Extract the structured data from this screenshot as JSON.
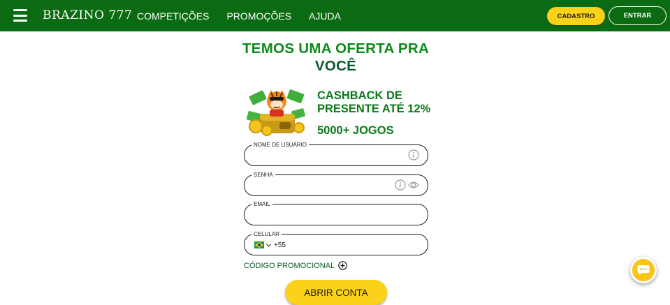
{
  "header": {
    "logo": "BRAZINO 777",
    "nav": [
      "COMPETIÇÕES",
      "PROMOÇÕES",
      "AJUDA"
    ],
    "signup_label": "CADASTRO",
    "login_label": "ENTRAR"
  },
  "hero": {
    "headline_line1": "TEMOS UMA OFERTA PRA",
    "headline_line2": "VOCÊ",
    "offer_line1": "CASHBACK DE",
    "offer_line2": "PRESENTE ATÉ 12%",
    "games": "5000+ JOGOS"
  },
  "form": {
    "username_label": "NOME DE USUÁRIO",
    "password_label": "SENHA",
    "email_label": "EMAIL",
    "phone_label": "CELULAR",
    "phone_prefix": "+55",
    "promo_code_label": "CÓDIGO PROMOCIONAL",
    "submit_label": "ABRIR CONTA"
  },
  "colors": {
    "header_green": "#0b6b12",
    "accent_yellow": "#fbd21a",
    "headline_green": "#0c8a1a"
  },
  "icons": [
    "menu-icon",
    "info-icon",
    "eye-icon",
    "brazil-flag-icon",
    "chevron-down-icon",
    "plus-circle-icon",
    "chat-icon"
  ]
}
